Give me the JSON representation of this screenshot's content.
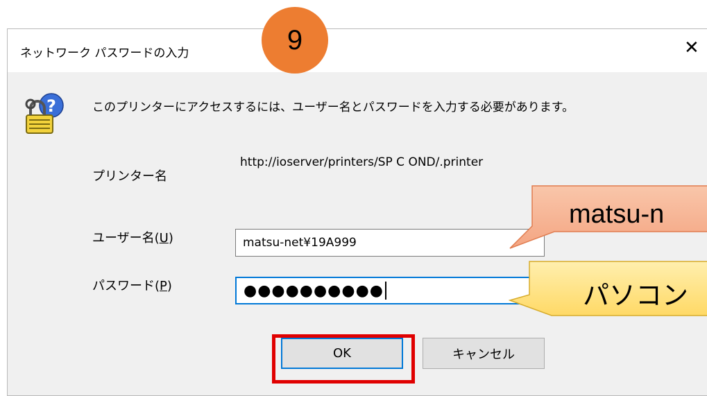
{
  "dialog": {
    "title": "ネットワーク パスワードの入力",
    "close_glyph": "✕",
    "message": "このプリンターにアクセスするには、ユーザー名とパスワードを入力する必要があります。",
    "key_icon": "key-lock-help-icon"
  },
  "step_badge": {
    "number": "9",
    "color": "#ed7d31"
  },
  "printer": {
    "label": "プリンター名",
    "value": "http://ioserver/printers/SP C OND/.printer"
  },
  "user": {
    "label": "ユーザー名(",
    "accel": "U",
    "label_end": ")",
    "value": "matsu-net¥19A999"
  },
  "password": {
    "label": "パスワード(",
    "accel": "P",
    "label_end": ")",
    "masked_value": "●●●●●●●●●●"
  },
  "buttons": {
    "ok": "OK",
    "cancel": "キャンセル"
  },
  "callouts": {
    "user_hint": {
      "text": "matsu-n",
      "color": "#f4a582"
    },
    "password_hint": {
      "text": "パソコン",
      "color": "#ffd966"
    }
  },
  "highlight_color": "#e00000",
  "accent_color": "#0078d7"
}
